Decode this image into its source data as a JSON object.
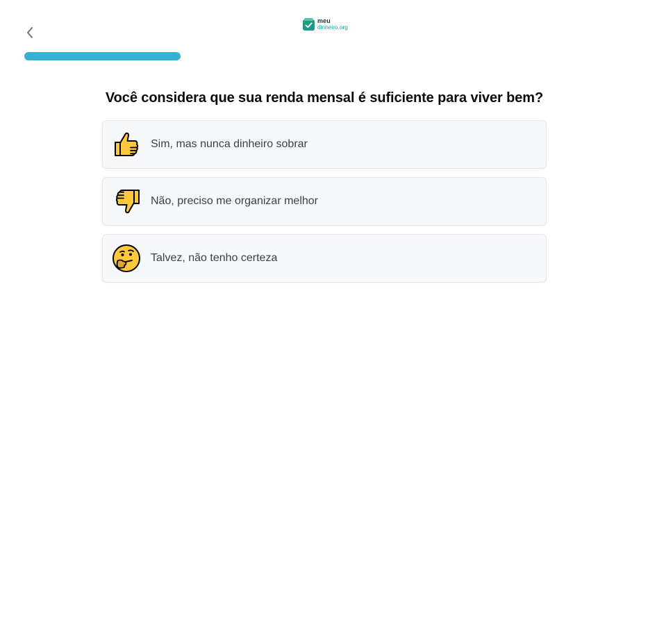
{
  "header": {
    "back_icon": "chevron-left-icon",
    "logo": {
      "line1": "meu",
      "line2": "dinheiro.org",
      "icon": "wallet-check-icon",
      "colors": {
        "mark": "#1e9a86",
        "text_dark": "#1f3b3a",
        "text_accent": "#1aa6a0"
      }
    }
  },
  "progress": {
    "value_fraction": 0.257,
    "color": "#37b1cf"
  },
  "question": {
    "title": "Você considera que sua renda mensal é suficiente para viver bem?",
    "options": [
      {
        "icon": "thumbs-up-icon",
        "label": "Sim, mas nunca dinheiro sobrar"
      },
      {
        "icon": "thumbs-down-icon",
        "label": "Não, preciso me organizar melhor"
      },
      {
        "icon": "thinking-face-icon",
        "label": "Talvez, não tenho certeza"
      }
    ]
  }
}
